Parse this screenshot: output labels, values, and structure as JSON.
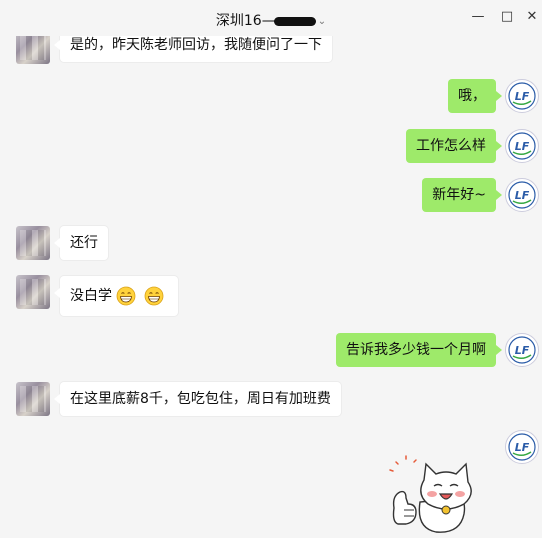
{
  "window": {
    "title": "深圳16—",
    "minimize_glyph": "—",
    "maximize_glyph": "□",
    "close_glyph": "✕"
  },
  "colors": {
    "bubble_self": "#9eea6a",
    "bubble_other": "#ffffff",
    "background": "#f5f5f5"
  },
  "messages": [
    {
      "side": "left",
      "text": "是的，昨天陈老师回访，我随便问了一下"
    },
    {
      "side": "right",
      "text": "哦，"
    },
    {
      "side": "right",
      "text": "工作怎么样"
    },
    {
      "side": "right",
      "text": "新年好~"
    },
    {
      "side": "left",
      "text": "还行"
    },
    {
      "side": "left",
      "text": "没白学",
      "emojis": [
        "grin-emoji",
        "grin-emoji"
      ]
    },
    {
      "side": "right",
      "text": "告诉我多少钱一个月啊"
    },
    {
      "side": "left",
      "text": "在这里底薪8千，包吃包住，周日有加班费"
    },
    {
      "side": "right",
      "sticker": "cat-thumbs-up-sticker"
    }
  ],
  "self_avatar_label": "LF"
}
